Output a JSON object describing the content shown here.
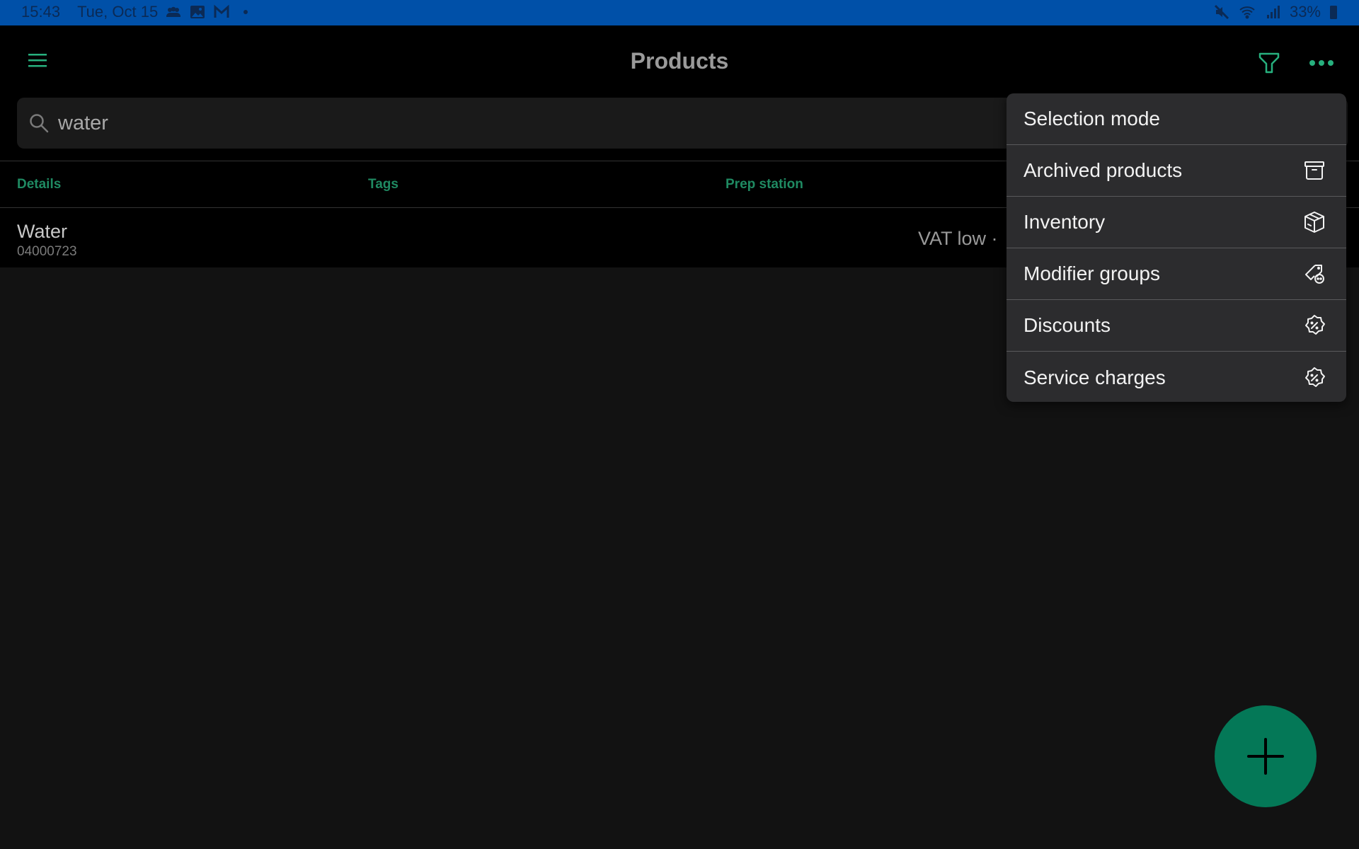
{
  "status_bar": {
    "time": "15:43",
    "date": "Tue, Oct 15",
    "notification_icons": [
      "group-icon",
      "image-icon",
      "gmail-icon",
      "dot-icon"
    ],
    "system_icons": [
      "mute-icon",
      "wifi-icon",
      "signal-icon"
    ],
    "battery": "33%"
  },
  "header": {
    "title": "Products",
    "menu_icon": "hamburger-menu-icon",
    "filter_icon": "filter-icon",
    "more_icon": "more-horizontal-icon"
  },
  "search": {
    "value": "water",
    "icon": "search-icon"
  },
  "table": {
    "columns": [
      {
        "label": "Details"
      },
      {
        "label": "Tags"
      },
      {
        "label": "Prep station"
      }
    ],
    "rows": [
      {
        "name": "Water",
        "code": "04000723",
        "tags": "",
        "prep_station": "",
        "vat": "VAT low ·"
      }
    ]
  },
  "dropdown_menu": {
    "items": [
      {
        "label": "Selection mode",
        "icon": ""
      },
      {
        "label": "Archived products",
        "icon": "archive-box-icon"
      },
      {
        "label": "Inventory",
        "icon": "package-icon"
      },
      {
        "label": "Modifier groups",
        "icon": "tag-icon"
      },
      {
        "label": "Discounts",
        "icon": "discount-badge-icon"
      },
      {
        "label": "Service charges",
        "icon": "discount-badge-icon"
      }
    ]
  },
  "fab": {
    "icon": "plus-icon",
    "color": "#047857"
  },
  "colors": {
    "accent": "#27b07e",
    "column_header": "#1f8a62",
    "status_bar": "#0050a8",
    "menu_bg": "#2c2c2e"
  }
}
